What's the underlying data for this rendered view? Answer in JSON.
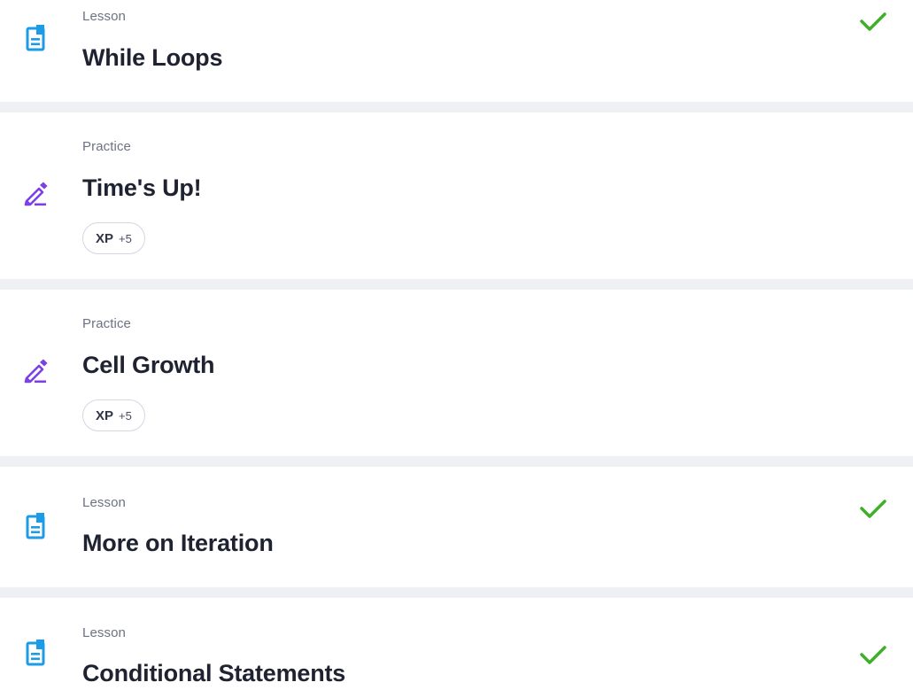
{
  "items": [
    {
      "type": "Lesson",
      "title": "While Loops",
      "icon": "lesson-doc-icon",
      "completed": true
    },
    {
      "type": "Practice",
      "title": "Time's Up!",
      "icon": "pencil-icon",
      "completed": false,
      "xp_label": "XP",
      "xp_value": "+5"
    },
    {
      "type": "Practice",
      "title": "Cell Growth",
      "icon": "pencil-icon",
      "completed": false,
      "xp_label": "XP",
      "xp_value": "+5"
    },
    {
      "type": "Lesson",
      "title": "More on Iteration",
      "icon": "lesson-doc-icon",
      "completed": true
    },
    {
      "type": "Lesson",
      "title": "Conditional Statements",
      "icon": "lesson-doc-icon",
      "completed": true
    }
  ],
  "colors": {
    "lesson_icon": "#1c9be6",
    "practice_icon": "#7b3fe4",
    "check": "#3fae29",
    "background": "#eef0f4"
  }
}
